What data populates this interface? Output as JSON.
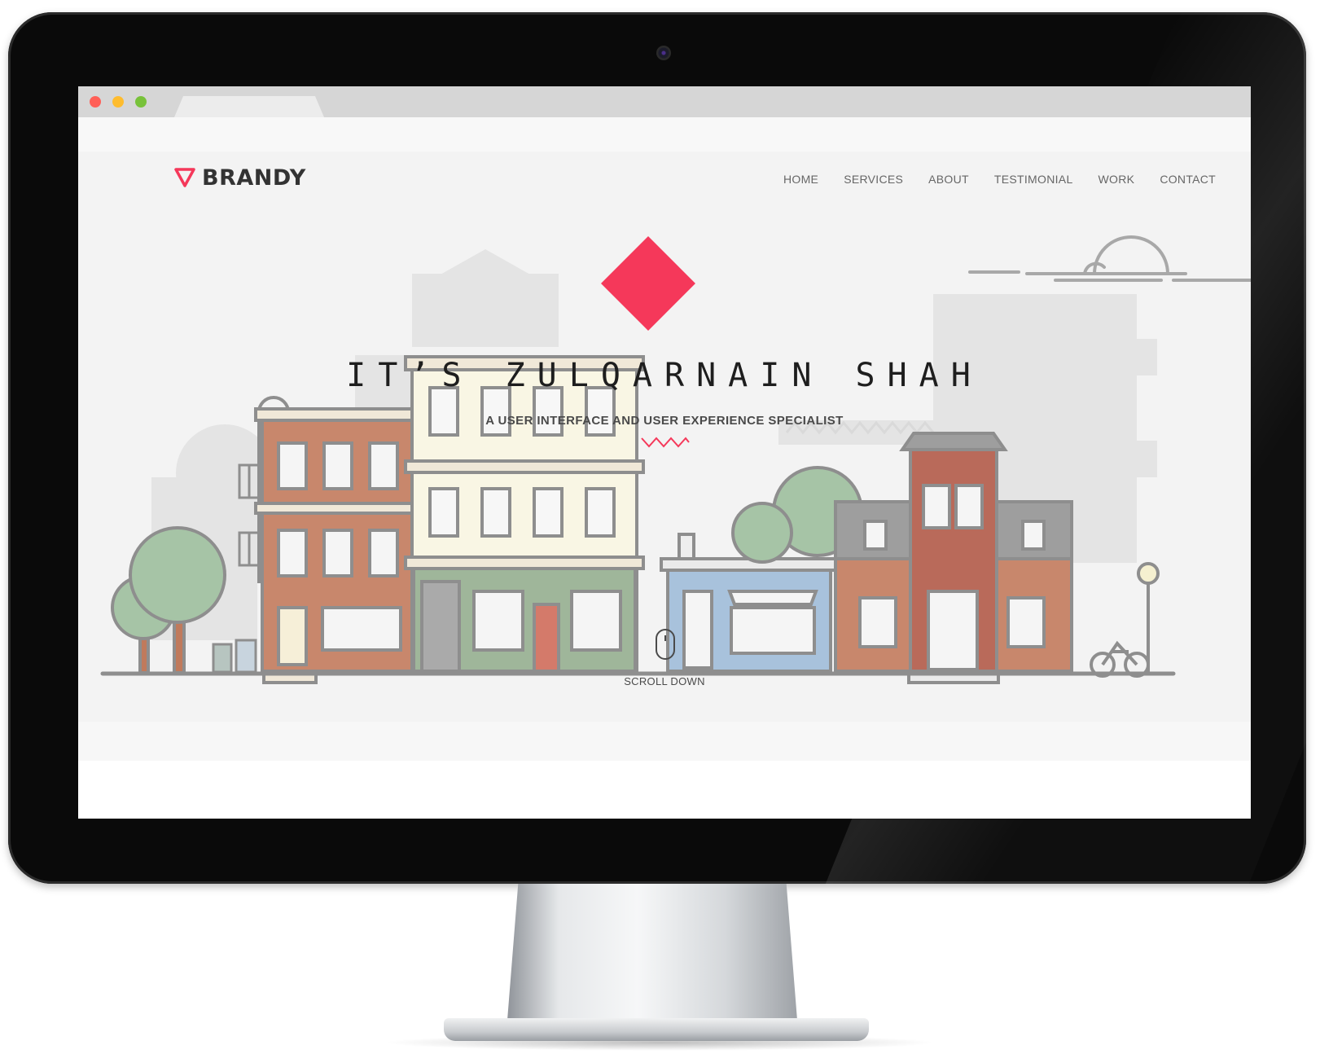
{
  "site": {
    "logo_text": "BRANDY",
    "nav": [
      "HOME",
      "SERVICES",
      "ABOUT",
      "TESTIMONIAL",
      "WORK",
      "CONTACT"
    ]
  },
  "hero": {
    "title": "IT’S ZULQARNAIN SHAH",
    "subtitle": "A USER INTERFACE AND USER EXPERIENCE SPECIALIST",
    "scroll_label": "SCROLL DOWN"
  },
  "colors": {
    "accent": "#f5385a",
    "bezel": "#0a0a0a",
    "page_background": "#f3f3f3"
  },
  "icons": [
    "logo-triangle-icon",
    "diamond-icon",
    "zigzag-icon",
    "mouse-scroll-icon"
  ]
}
